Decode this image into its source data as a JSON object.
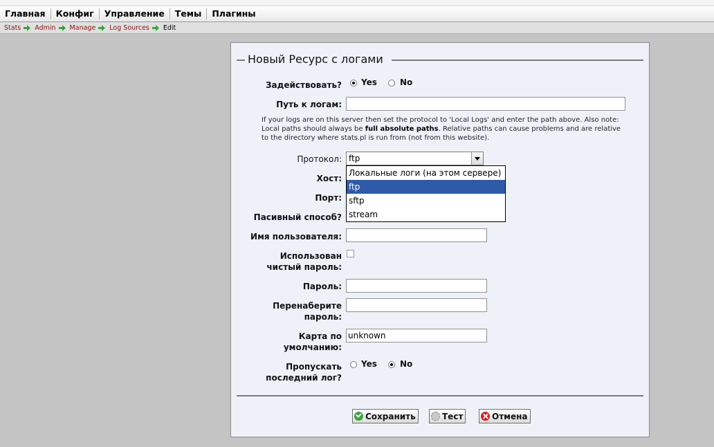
{
  "nav": {
    "items": [
      "Главная",
      "Конфиг",
      "Управление",
      "Темы",
      "Плагины"
    ]
  },
  "breadcrumb": {
    "items": [
      "Stats",
      "Admin",
      "Manage",
      "Log Sources"
    ],
    "current": "Edit"
  },
  "form": {
    "title": "Новый Ресурс с логами",
    "enable_label": "Задействовать?",
    "yes": "Yes",
    "no": "No",
    "enable_value": "Yes",
    "path_label": "Путь к логам:",
    "path_value": "",
    "note_part1": "If your logs are on this server then set the protocol to 'Local Logs' and enter the path above. Also note: Local paths should always be ",
    "note_bold": "full absolute paths",
    "note_part2": ". Relative paths can cause problems and are relative to the directory where stats.pl is run from (not from this website).",
    "protocol_label": "Протокол:",
    "protocol_value": "ftp",
    "protocol_options": [
      "Локальные логи (на этом сервере)",
      "ftp",
      "sftp",
      "stream"
    ],
    "host_label": "Хост:",
    "port_label": "Порт:",
    "passive_label": "Пасивный способ?",
    "username_label": "Имя пользователя:",
    "username_value": "",
    "cleartext_label_1": "Использован",
    "cleartext_label_2": "чистый пароль:",
    "password_label": "Пароль:",
    "retype_label_1": "Перенаберите",
    "retype_label_2": "пароль:",
    "map_label_1": "Карта по",
    "map_label_2": "умолчанию:",
    "map_value": "unknown",
    "skip_label_1": "Пропускать",
    "skip_label_2": "последний лог?",
    "skip_value": "No"
  },
  "buttons": {
    "save": "Сохранить",
    "test": "Тест",
    "cancel": "Отмена"
  },
  "colors": {
    "selected_option": "#2e5ba8",
    "breadcrumb_link": "#8a1010",
    "arrow": "#3aa33a"
  }
}
